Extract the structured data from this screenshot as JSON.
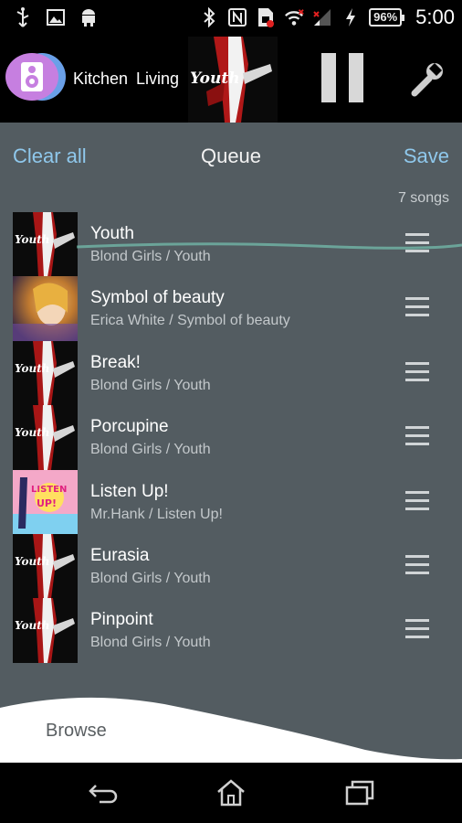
{
  "status_bar": {
    "icons_left": [
      "usb-icon",
      "image-icon",
      "android-icon"
    ],
    "icons_right": [
      "bluetooth-icon",
      "nfc-icon",
      "sim-icon",
      "wifi-icon",
      "signal-icon",
      "charging-icon"
    ],
    "battery": "96%",
    "time": "5:00"
  },
  "top_bar": {
    "speakers_label": "Kitchen  Living",
    "album_art_text": "Youth",
    "play_state": "paused"
  },
  "queue": {
    "clear_all": "Clear all",
    "title": "Queue",
    "save": "Save",
    "count": "7 songs",
    "songs": [
      {
        "title": "Youth",
        "subtitle": "Blond Girls / Youth",
        "art": "youth"
      },
      {
        "title": "Symbol of beauty",
        "subtitle": "Erica White / Symbol of beauty",
        "art": "beauty"
      },
      {
        "title": "Break!",
        "subtitle": "Blond Girls / Youth",
        "art": "youth"
      },
      {
        "title": "Porcupine",
        "subtitle": "Blond Girls / Youth",
        "art": "youth"
      },
      {
        "title": "Listen Up!",
        "subtitle": "Mr.Hank / Listen Up!",
        "art": "listen"
      },
      {
        "title": "Eurasia",
        "subtitle": "Blond Girls / Youth",
        "art": "youth"
      },
      {
        "title": "Pinpoint",
        "subtitle": "Blond Girls / Youth",
        "art": "youth"
      }
    ]
  },
  "browse": {
    "label": "Browse"
  },
  "nav_bar": {
    "buttons": [
      "back-icon",
      "home-icon",
      "recent-apps-icon"
    ]
  },
  "colors": {
    "accent": "#8fc8ec",
    "panel": "#535c61",
    "speaker_badge": "#c67fe0"
  }
}
